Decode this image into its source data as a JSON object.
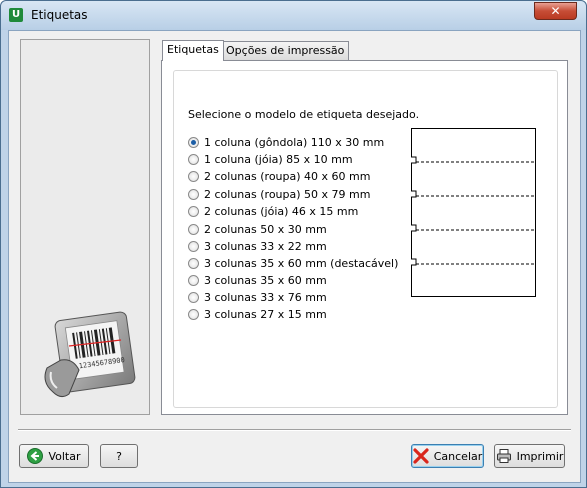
{
  "window": {
    "title": "Etiquetas",
    "close_glyph": "✕",
    "app_icon": "U"
  },
  "tabs": [
    {
      "label": "Etiquetas",
      "active": true
    },
    {
      "label": "Opções de impressão",
      "active": false
    }
  ],
  "main": {
    "prompt": "Selecione o modelo de etiqueta desejado.",
    "options": [
      {
        "label": "1 coluna (gôndola) 110 x 30 mm",
        "checked": true
      },
      {
        "label": "1 coluna (jóia) 85 x 10 mm",
        "checked": false
      },
      {
        "label": "2 colunas (roupa) 40 x 60 mm",
        "checked": false
      },
      {
        "label": "2 colunas (roupa) 50 x 79 mm",
        "checked": false
      },
      {
        "label": "2 colunas (jóia) 46 x 15 mm",
        "checked": false
      },
      {
        "label": "2 colunas 50 x 30 mm",
        "checked": false
      },
      {
        "label": "3 colunas 33 x 22 mm",
        "checked": false
      },
      {
        "label": "3 colunas 35 x 60 mm (destacável)",
        "checked": false
      },
      {
        "label": "3 colunas 35 x 60 mm",
        "checked": false
      },
      {
        "label": "3 colunas 33 x 76 mm",
        "checked": false
      },
      {
        "label": "3 colunas 27 x 15 mm",
        "checked": false
      }
    ],
    "logo_barcode_number": "12345678900"
  },
  "buttons": {
    "back": "Voltar",
    "help": "?",
    "cancel": "Cancelar",
    "print": "Imprimir"
  },
  "icons": {
    "back": "green-arrow-left-icon",
    "cancel": "red-x-icon",
    "print": "printer-icon"
  }
}
